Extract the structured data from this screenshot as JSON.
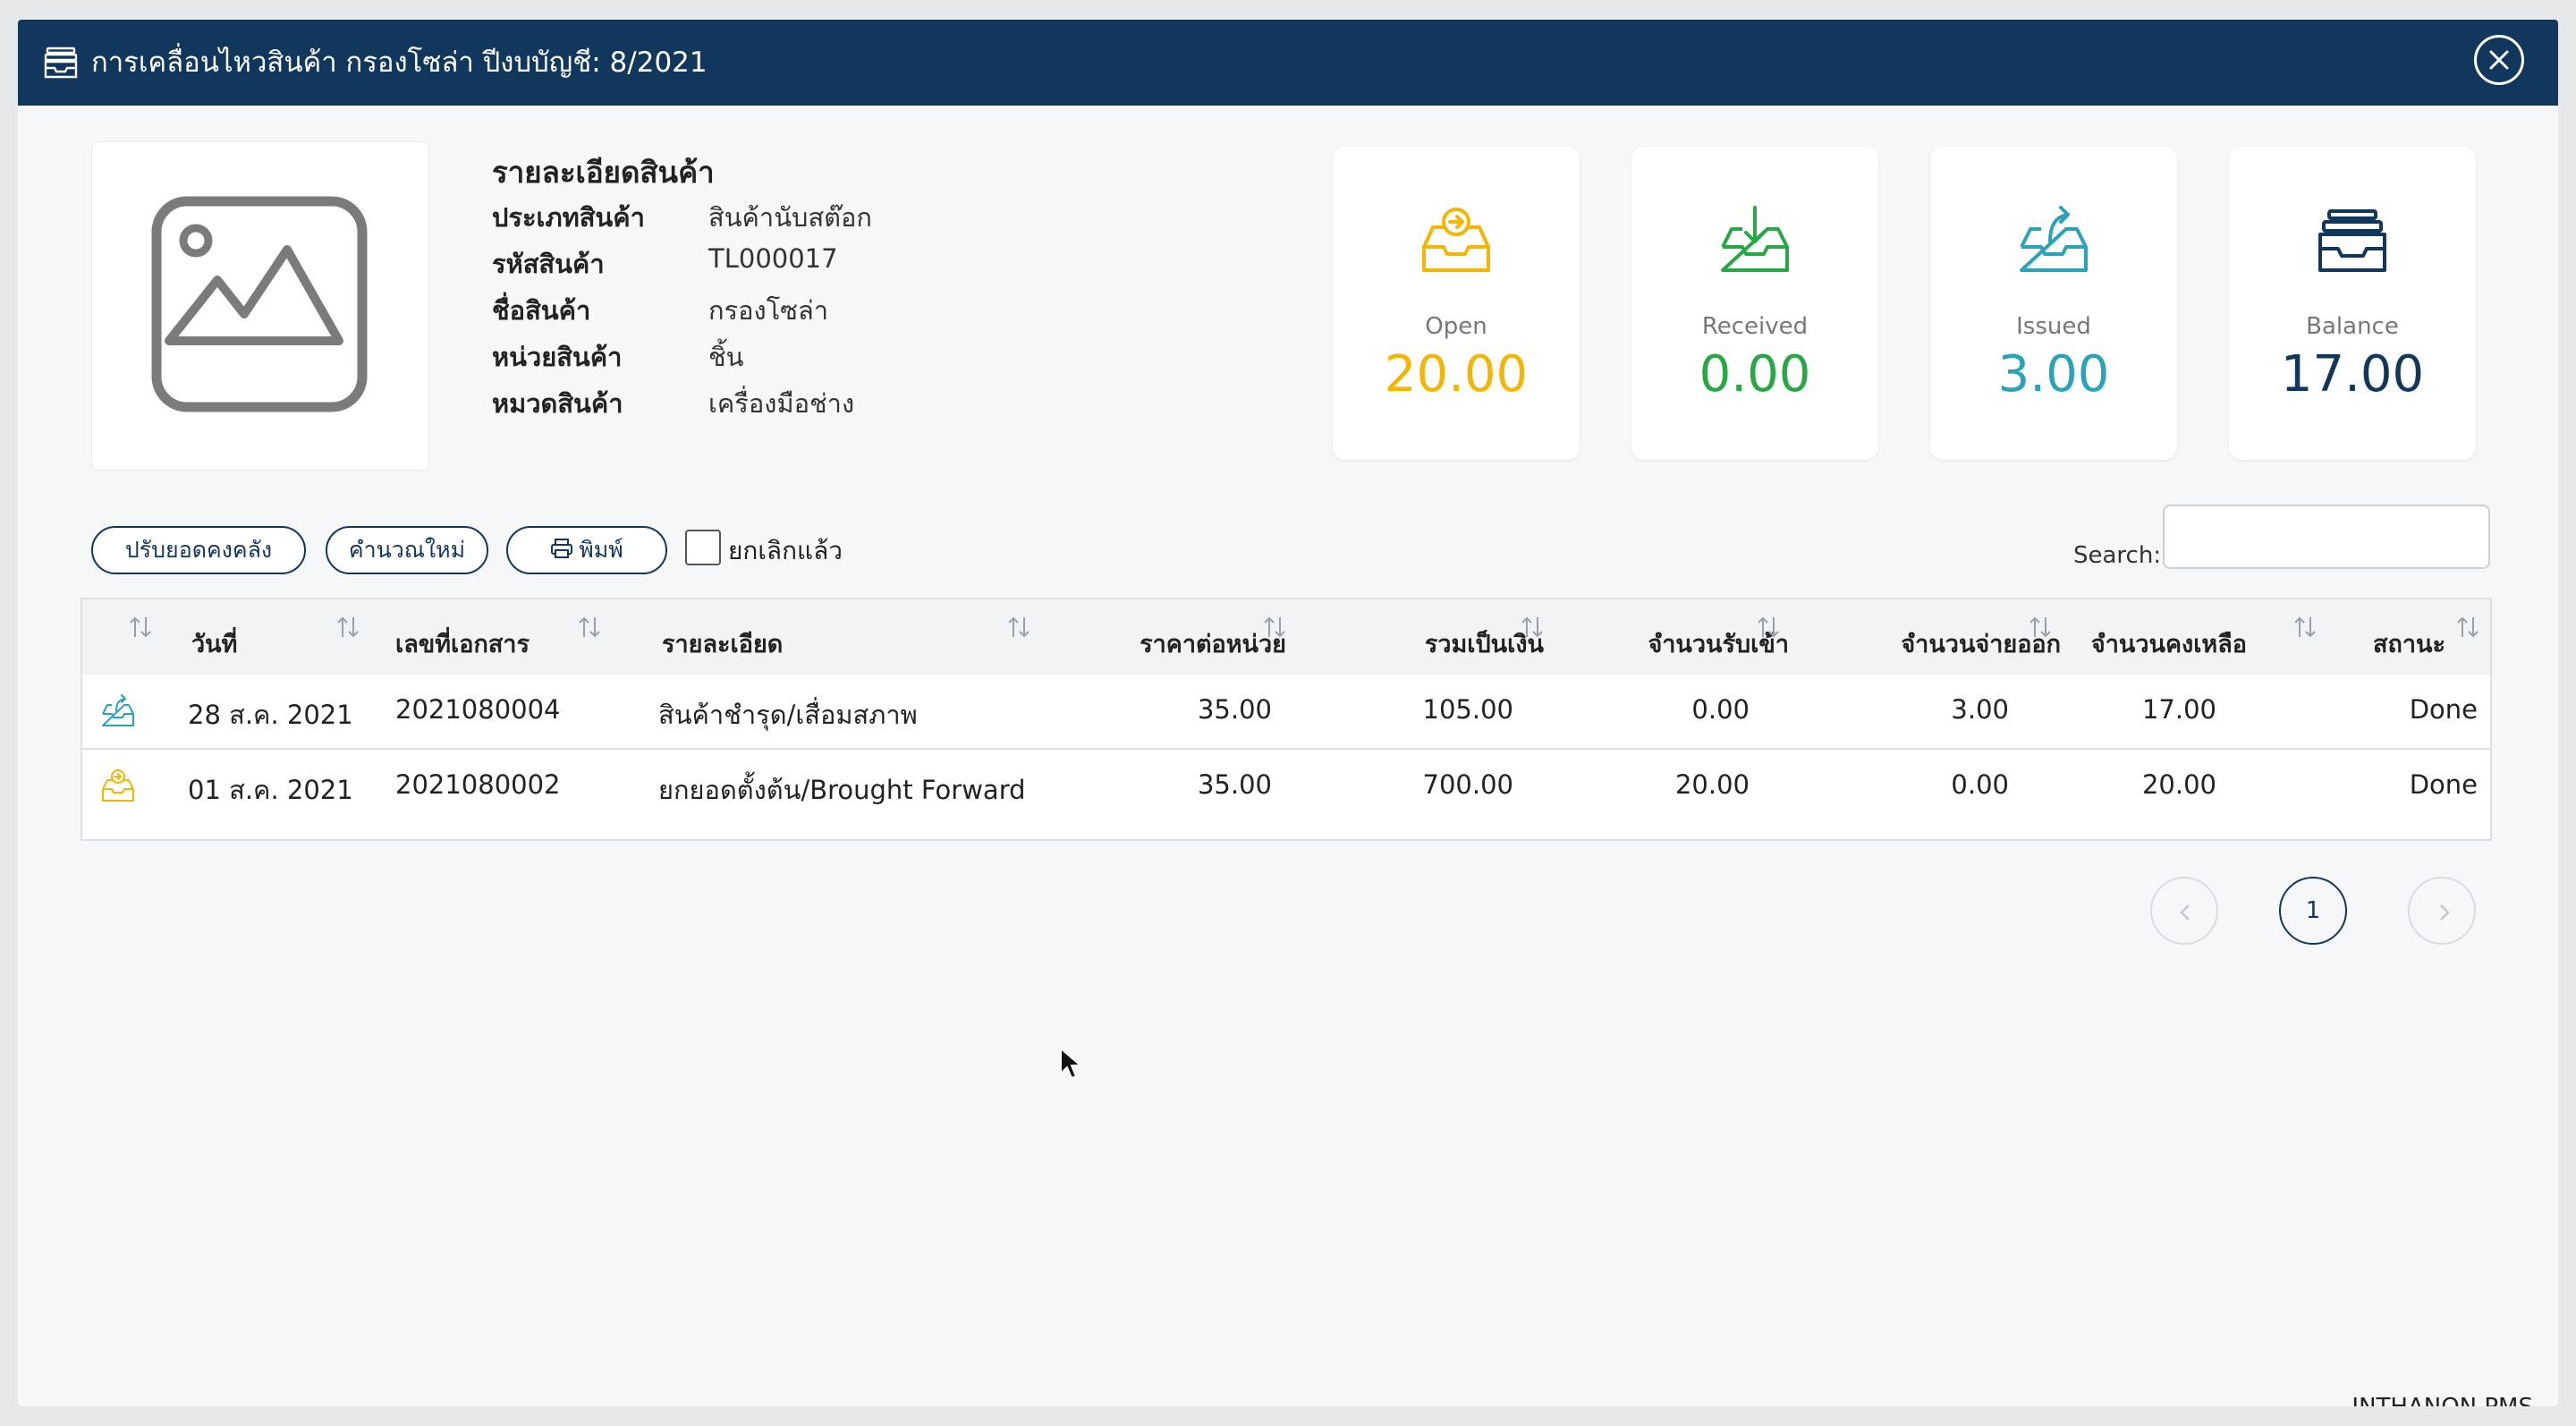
{
  "window": {
    "title": "การเคลื่อนไหวสินค้า กรองโซล่า ปีงบบัญชี: 8/2021",
    "header_icon": "archive-box-icon",
    "close_icon": "close-icon"
  },
  "product": {
    "image_icon": "image-placeholder-icon",
    "section_title": "รายละเอียดสินค้า",
    "fields": [
      {
        "label": "ประเภทสินค้า",
        "value": "สินค้านับสต๊อก"
      },
      {
        "label": "รหัสสินค้า",
        "value": "TL000017"
      },
      {
        "label": "ชื่อสินค้า",
        "value": "กรองโซล่า"
      },
      {
        "label": "หน่วยสินค้า",
        "value": "ชิ้น"
      },
      {
        "label": "หมวดสินค้า",
        "value": "เครื่องมือช่าง"
      }
    ]
  },
  "stats": [
    {
      "label": "Open",
      "value": "20.00",
      "icon": "inbox-in-icon",
      "color": "#f2b705"
    },
    {
      "label": "Received",
      "value": "0.00",
      "icon": "inbox-download-icon",
      "color": "#28a745"
    },
    {
      "label": "Issued",
      "value": "3.00",
      "icon": "inbox-upload-icon",
      "color": "#2aa3b8"
    },
    {
      "label": "Balance",
      "value": "17.00",
      "icon": "archive-box-icon",
      "color": "#12375c"
    }
  ],
  "toolbar": {
    "adjust_label": "ปรับยอดคงคลัง",
    "recalc_label": "คำนวณใหม่",
    "print_label": "พิมพ์",
    "print_icon": "printer-icon",
    "cancelled_label": "ยกเลิกแล้ว",
    "cancelled_checked": false,
    "search_label": "Search:",
    "search_value": ""
  },
  "table": {
    "columns": [
      "",
      "วันที่",
      "เลขที่เอกสาร",
      "รายละเอียด",
      "ราคาต่อหน่วย",
      "รวมเป็นเงิน",
      "จำนวนรับเข้า",
      "จำนวนจ่ายออก",
      "จำนวนคงเหลือ",
      "สถานะ"
    ],
    "rows": [
      {
        "icon": "inbox-upload-icon",
        "date": "28 ส.ค. 2021",
        "doc_no": "2021080004",
        "detail": "สินค้าชำรุด/เสื่อมสภาพ",
        "unit_price": "35.00",
        "total": "105.00",
        "qty_in": "0.00",
        "qty_out": "3.00",
        "qty_balance": "17.00",
        "status": "Done"
      },
      {
        "icon": "inbox-in-icon",
        "date": "01 ส.ค. 2021",
        "doc_no": "2021080002",
        "detail": "ยกยอดตั้งต้น/Brought Forward",
        "unit_price": "35.00",
        "total": "700.00",
        "qty_in": "20.00",
        "qty_out": "0.00",
        "qty_balance": "20.00",
        "status": "Done"
      }
    ]
  },
  "pagination": {
    "prev_icon": "chevron-left-icon",
    "current_page": "1",
    "next_icon": "chevron-right-icon"
  },
  "footer": {
    "brand": "INTHANON PMS"
  }
}
